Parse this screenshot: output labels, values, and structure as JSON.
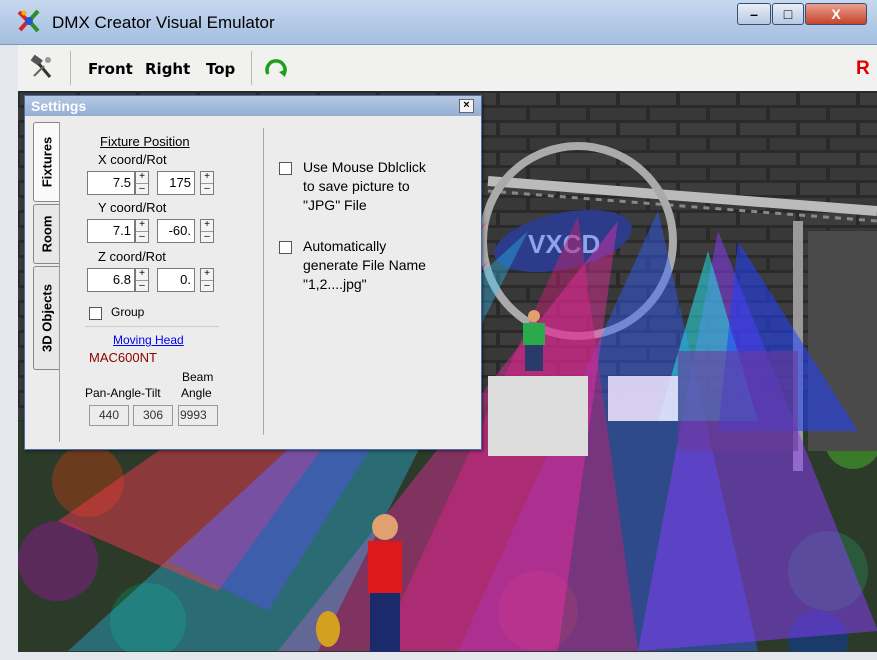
{
  "window": {
    "title": "DMX Creator Visual Emulator",
    "controls": {
      "minimize": "–",
      "maximize": "□",
      "close": "X"
    }
  },
  "toolbar": {
    "front_label": "Front",
    "right_label": "Right",
    "top_label": "Top",
    "record_label": "R"
  },
  "settings": {
    "title": "Settings",
    "close_label": "×",
    "tabs": [
      "Fixtures",
      "Room",
      "3D Objects"
    ],
    "active_tab": "Fixtures",
    "fixture_position_label": "Fixture Position",
    "x_label": "X coord/Rot",
    "x_value": "7.5",
    "x_rot": "175",
    "y_label": "Y coord/Rot",
    "y_value": "7.1",
    "y_rot": "-60.",
    "z_label": "Z coord/Rot",
    "z_value": "6.8",
    "z_rot": "0.",
    "group_label": "Group",
    "group_checked": false,
    "fixture_type": "Moving Head",
    "fixture_model": "MAC600NT",
    "pan_angle_tilt_label": "Pan-Angle-Tilt",
    "beam_label": "Beam",
    "angle_label": "Angle",
    "pan": "440",
    "tilt": "306",
    "beam_angle": "9993",
    "option1_checked": false,
    "option1_lines": [
      "Use Mouse Dblclick",
      "to save picture to",
      "\"JPG\" File"
    ],
    "option2_checked": false,
    "option2_lines": [
      "Automatically",
      "generate File Name",
      "\"1,2....jpg\""
    ]
  },
  "scene": {
    "sign_text": "VXCD"
  },
  "colors": {
    "titlebar": "#b6cce8",
    "close_button": "#c6432a",
    "record": "#e00000",
    "link": "#0000ee",
    "model_text": "#8b0000"
  }
}
